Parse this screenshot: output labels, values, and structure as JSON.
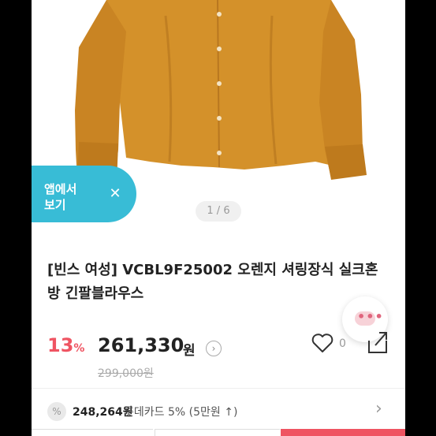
{
  "app_banner": {
    "label": "앱에서\n보기",
    "close_symbol": "✕"
  },
  "gallery": {
    "pager": "1 / 6"
  },
  "product": {
    "title": "[빈스 여성] VCBL9F25002 오렌지 셔링장식 실크혼방 긴팔블라우스",
    "discount": "13",
    "discount_unit": "%",
    "price": "261,330",
    "price_unit": "원",
    "original_price": "299,000원",
    "like_count": "0"
  },
  "card_benefit": {
    "price": "248,264원",
    "text": "롯데카드 5% (5만원 ↑)"
  },
  "colors": {
    "accent": "#ef5462",
    "banner": "#38bcd6",
    "blouse": "#d4912a"
  },
  "icons": [
    "chat-icon",
    "heart-icon",
    "share-icon",
    "percent-icon",
    "chevron-right-icon",
    "close-icon"
  ]
}
